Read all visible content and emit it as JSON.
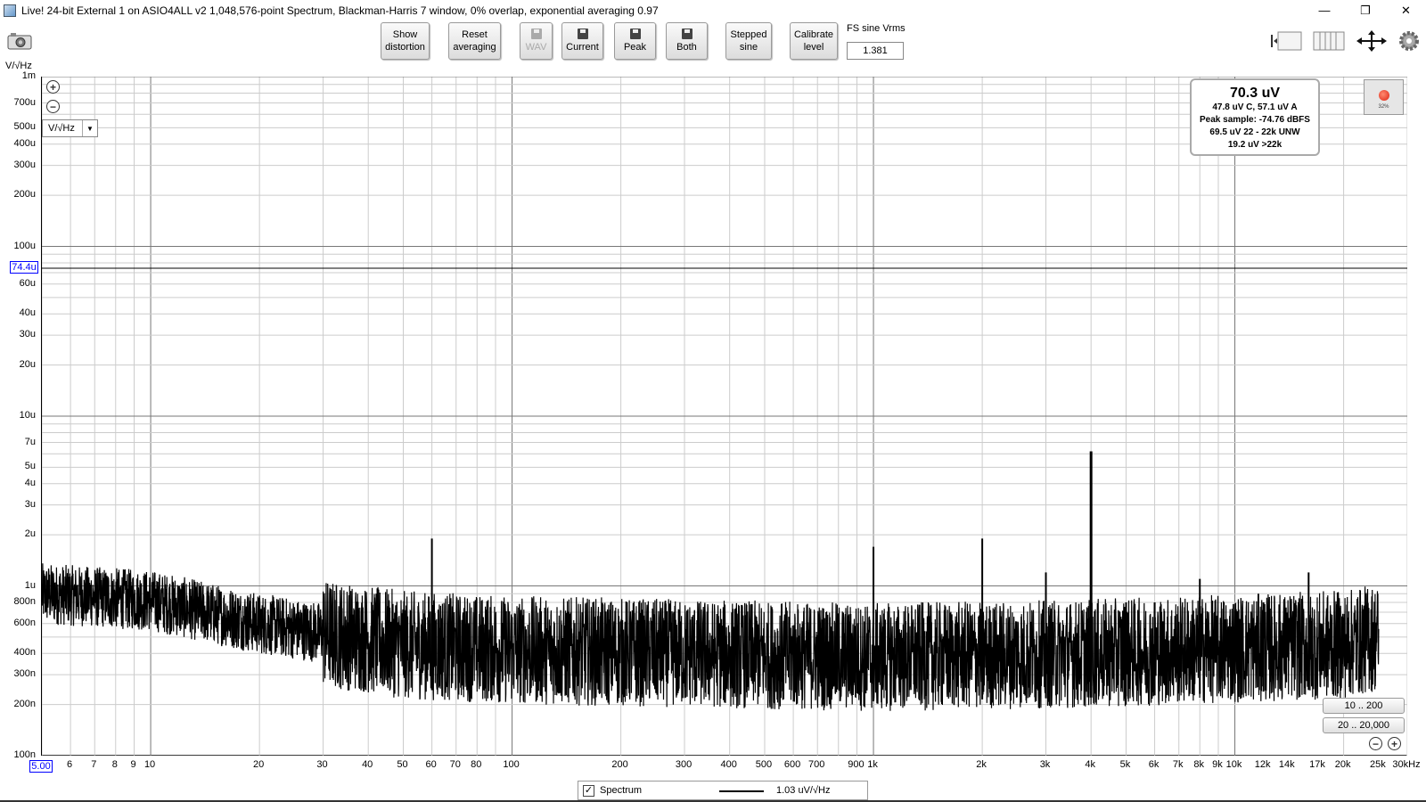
{
  "window": {
    "title": "Live! 24-bit External 1 on ASIO4ALL v2 1,048,576-point Spectrum, Blackman-Harris 7 window, 0% overlap, exponential averaging 0.97",
    "minimize": "—",
    "restore": "❐",
    "close": "✕"
  },
  "toolbar": {
    "show_distortion": [
      "Show",
      "distortion"
    ],
    "reset_averaging": [
      "Reset",
      "averaging"
    ],
    "wav": "WAV",
    "current": "Current",
    "peak": "Peak",
    "both": "Both",
    "stepped_sine": [
      "Stepped",
      "sine"
    ],
    "calibrate_level": [
      "Calibrate",
      "level"
    ],
    "fs_label": "FS sine Vrms",
    "fs_value": "1.381"
  },
  "plot": {
    "y_unit": "V/√Hz",
    "y_dropdown": "V/√Hz",
    "cursor_label": "74.4u",
    "x_start_label": "5.00",
    "y_ticks": [
      {
        "v": 0.001,
        "t": "1m"
      },
      {
        "v": 0.0007,
        "t": "700u"
      },
      {
        "v": 0.0005,
        "t": "500u"
      },
      {
        "v": 0.0004,
        "t": "400u"
      },
      {
        "v": 0.0003,
        "t": "300u"
      },
      {
        "v": 0.0002,
        "t": "200u"
      },
      {
        "v": 0.0001,
        "t": "100u"
      },
      {
        "v": 6e-05,
        "t": "60u"
      },
      {
        "v": 4e-05,
        "t": "40u"
      },
      {
        "v": 3e-05,
        "t": "30u"
      },
      {
        "v": 2e-05,
        "t": "20u"
      },
      {
        "v": 1e-05,
        "t": "10u"
      },
      {
        "v": 7e-06,
        "t": "7u"
      },
      {
        "v": 5e-06,
        "t": "5u"
      },
      {
        "v": 4e-06,
        "t": "4u"
      },
      {
        "v": 3e-06,
        "t": "3u"
      },
      {
        "v": 2e-06,
        "t": "2u"
      },
      {
        "v": 1e-06,
        "t": "1u"
      },
      {
        "v": 8e-07,
        "t": "800n"
      },
      {
        "v": 6e-07,
        "t": "600n"
      },
      {
        "v": 4e-07,
        "t": "400n"
      },
      {
        "v": 3e-07,
        "t": "300n"
      },
      {
        "v": 2e-07,
        "t": "200n"
      },
      {
        "v": 1e-07,
        "t": "100n"
      }
    ],
    "x_ticks": [
      {
        "v": 6,
        "t": "6"
      },
      {
        "v": 7,
        "t": "7"
      },
      {
        "v": 8,
        "t": "8"
      },
      {
        "v": 9,
        "t": "9"
      },
      {
        "v": 10,
        "t": "10"
      },
      {
        "v": 20,
        "t": "20"
      },
      {
        "v": 30,
        "t": "30"
      },
      {
        "v": 40,
        "t": "40"
      },
      {
        "v": 50,
        "t": "50"
      },
      {
        "v": 60,
        "t": "60"
      },
      {
        "v": 70,
        "t": "70"
      },
      {
        "v": 80,
        "t": "80"
      },
      {
        "v": 100,
        "t": "100"
      },
      {
        "v": 200,
        "t": "200"
      },
      {
        "v": 300,
        "t": "300"
      },
      {
        "v": 400,
        "t": "400"
      },
      {
        "v": 500,
        "t": "500"
      },
      {
        "v": 600,
        "t": "600"
      },
      {
        "v": 700,
        "t": "700"
      },
      {
        "v": 900,
        "t": "900"
      },
      {
        "v": 1000,
        "t": "1k"
      },
      {
        "v": 2000,
        "t": "2k"
      },
      {
        "v": 3000,
        "t": "3k"
      },
      {
        "v": 4000,
        "t": "4k"
      },
      {
        "v": 5000,
        "t": "5k"
      },
      {
        "v": 6000,
        "t": "6k"
      },
      {
        "v": 7000,
        "t": "7k"
      },
      {
        "v": 8000,
        "t": "8k"
      },
      {
        "v": 9000,
        "t": "9k"
      },
      {
        "v": 10000,
        "t": "10k"
      },
      {
        "v": 12000,
        "t": "12k"
      },
      {
        "v": 14000,
        "t": "14k"
      },
      {
        "v": 17000,
        "t": "17k"
      },
      {
        "v": 20000,
        "t": "20k"
      },
      {
        "v": 25000,
        "t": "25k"
      },
      {
        "v": 30000,
        "t": "30kHz"
      }
    ]
  },
  "readout": {
    "main": "70.3 uV",
    "lines": [
      "47.8 uV C, 57.1 uV A",
      "Peak sample: -74.76 dBFS",
      "69.5 uV 22 - 22k UNW",
      "19.2 uV >22k"
    ]
  },
  "record": {
    "percent": "32%"
  },
  "range_buttons": [
    "10 .. 200",
    "20 .. 20,000"
  ],
  "legend": {
    "name": "Spectrum",
    "value": "1.03 uV/√Hz",
    "checked": "✓"
  },
  "chart_data": {
    "type": "line",
    "xscale": "log",
    "yscale": "log",
    "xlim": [
      5,
      30000
    ],
    "ylim": [
      1e-07,
      0.001
    ],
    "grid": true,
    "cursor_level": 7.44e-05,
    "series": [
      {
        "name": "Spectrum",
        "noise_floor": [
          [
            5,
            9e-07
          ],
          [
            10,
            8.2e-07
          ],
          [
            20,
            6e-07
          ],
          [
            50,
            4.5e-07
          ],
          [
            100,
            4.2e-07
          ],
          [
            1000,
            3.8e-07
          ],
          [
            4000,
            4e-07
          ],
          [
            20000,
            4.5e-07
          ],
          [
            25000,
            5e-07
          ]
        ],
        "spikes": [
          {
            "x": 60,
            "y": 1.9e-06
          },
          {
            "x": 1000,
            "y": 1.7e-06
          },
          {
            "x": 2000,
            "y": 1.9e-06
          },
          {
            "x": 3000,
            "y": 1.2e-06
          },
          {
            "x": 4000,
            "y": 6.2e-06
          },
          {
            "x": 5000,
            "y": 8e-07
          },
          {
            "x": 6000,
            "y": 8e-07
          },
          {
            "x": 8000,
            "y": 1.1e-06
          },
          {
            "x": 12000,
            "y": 8e-07
          },
          {
            "x": 16000,
            "y": 1.2e-06
          }
        ]
      }
    ]
  }
}
